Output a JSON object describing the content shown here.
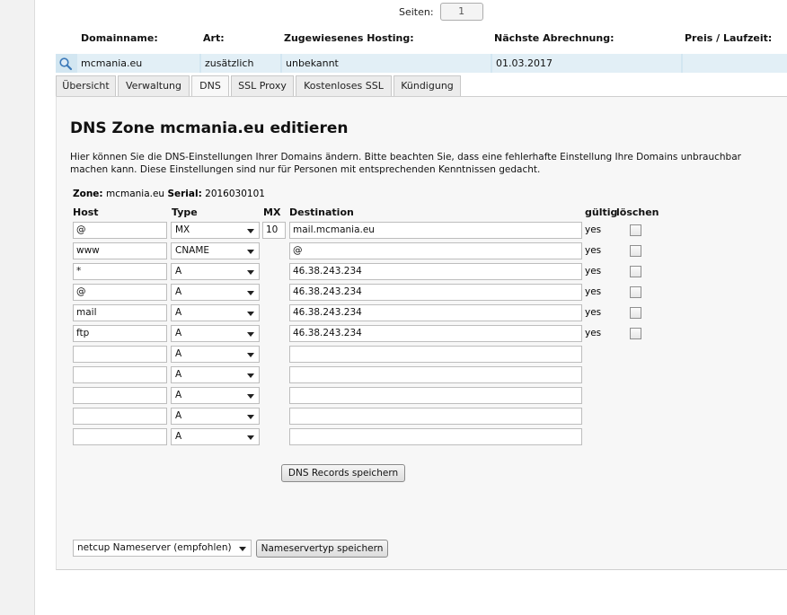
{
  "pager": {
    "label": "Seiten:",
    "value": "1"
  },
  "columns": {
    "domainname": "Domainname:",
    "art": "Art:",
    "hosting": "Zugewiesenes Hosting:",
    "abrechnung": "Nächste Abrechnung:",
    "preis": "Preis / Laufzeit:"
  },
  "domain_row": {
    "domain": "mcmania.eu",
    "art": "zusätzlich",
    "hosting": "unbekannt",
    "abrechnung": "01.03.2017",
    "preis": ""
  },
  "tabs": [
    "Übersicht",
    "Verwaltung",
    "DNS",
    "SSL Proxy",
    "Kostenloses SSL",
    "Kündigung"
  ],
  "active_tab": "DNS",
  "panel": {
    "title": "DNS Zone mcmania.eu editieren",
    "description": "Hier können Sie die DNS-Einstellungen Ihrer Domains ändern. Bitte beachten Sie, dass eine fehlerhafte Einstellung Ihre Domains unbrauchbar machen kann. Diese Einstellungen sind nur für Personen mit entsprechenden Kenntnissen gedacht.",
    "zone_label": "Zone:",
    "zone_value": "mcmania.eu",
    "serial_label": "Serial:",
    "serial_value": "2016030101"
  },
  "table_headers": {
    "host": "Host",
    "type": "Type",
    "mx": "MX",
    "destination": "Destination",
    "valid": "gültig",
    "delete": "löschen"
  },
  "records": [
    {
      "host": "@",
      "type": "MX",
      "mx": "10",
      "destination": "mail.mcmania.eu",
      "valid": "yes"
    },
    {
      "host": "www",
      "type": "CNAME",
      "mx": "",
      "destination": "@",
      "valid": "yes"
    },
    {
      "host": "*",
      "type": "A",
      "mx": "",
      "destination": "46.38.243.234",
      "valid": "yes"
    },
    {
      "host": "@",
      "type": "A",
      "mx": "",
      "destination": "46.38.243.234",
      "valid": "yes"
    },
    {
      "host": "mail",
      "type": "A",
      "mx": "",
      "destination": "46.38.243.234",
      "valid": "yes"
    },
    {
      "host": "ftp",
      "type": "A",
      "mx": "",
      "destination": "46.38.243.234",
      "valid": "yes"
    }
  ],
  "empty_rows": [
    {
      "type": "A"
    },
    {
      "type": "A"
    },
    {
      "type": "A"
    },
    {
      "type": "A"
    },
    {
      "type": "A"
    }
  ],
  "save_records_label": "DNS Records speichern",
  "nameserver": {
    "selected": "netcup Nameserver (empfohlen)",
    "save_label": "Nameservertyp speichern"
  },
  "icons": {
    "search": "search-icon",
    "dropdown": "chevron-down-icon"
  },
  "colors": {
    "row_highlight": "#d2e6f1",
    "panel_bg": "#f7f7f7"
  }
}
